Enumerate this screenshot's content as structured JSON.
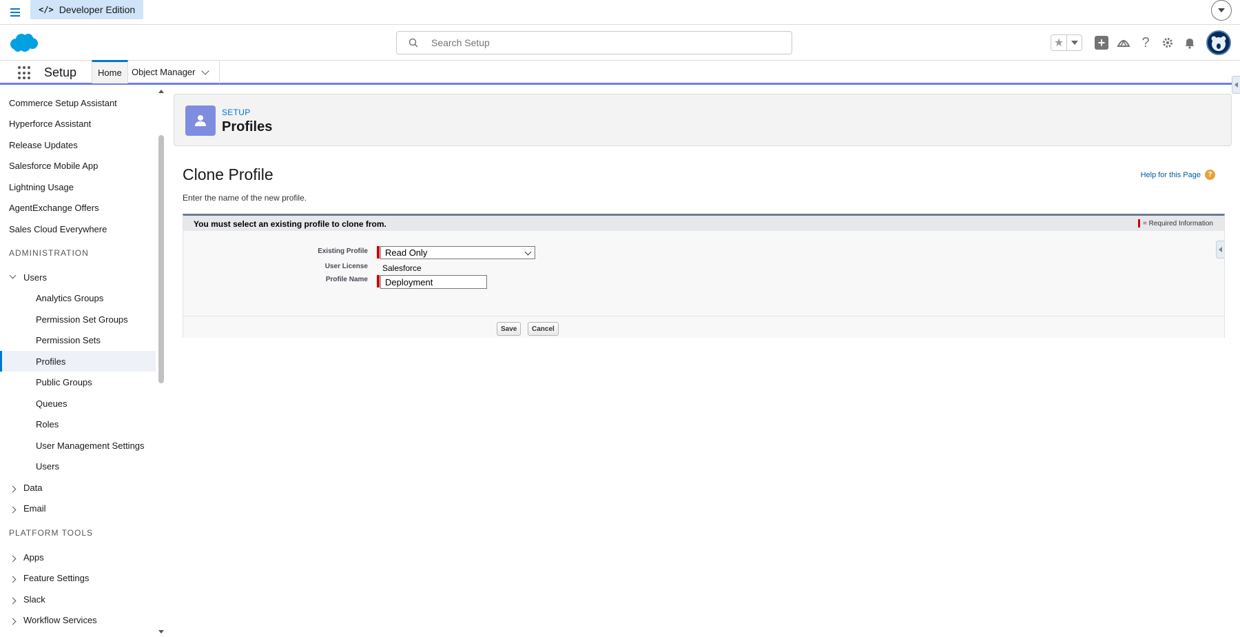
{
  "topbar": {
    "edition_label": "Developer Edition"
  },
  "header": {
    "search_placeholder": "Search Setup"
  },
  "navbar": {
    "app_name": "Setup",
    "tab_home": "Home",
    "tab_object_manager": "Object Manager"
  },
  "sidebar": {
    "items_top": [
      "Commerce Setup Assistant",
      "Hyperforce Assistant",
      "Release Updates",
      "Salesforce Mobile App",
      "Lightning Usage",
      "AgentExchange Offers",
      "Sales Cloud Everywhere"
    ],
    "heading_admin": "ADMINISTRATION",
    "users_group": "Users",
    "users_children": [
      "Analytics Groups",
      "Permission Set Groups",
      "Permission Sets",
      "Profiles",
      "Public Groups",
      "Queues",
      "Roles",
      "User Management Settings",
      "Users"
    ],
    "active_item": "Profiles",
    "data_group": "Data",
    "email_group": "Email",
    "heading_platform": "PLATFORM TOOLS",
    "platform_groups": [
      "Apps",
      "Feature Settings",
      "Slack",
      "Workflow Services"
    ]
  },
  "page_header": {
    "eyebrow": "SETUP",
    "title": "Profiles"
  },
  "clone": {
    "title": "Clone Profile",
    "help_link": "Help for this Page",
    "help_icon_glyph": "?",
    "instructions": "Enter the name of the new profile.",
    "banner": "You must select an existing profile to clone from.",
    "required_info": "= Required Information",
    "fields": {
      "existing_profile_label": "Existing Profile",
      "existing_profile_value": "Read Only",
      "user_license_label": "User License",
      "user_license_value": "Salesforce",
      "profile_name_label": "Profile Name",
      "profile_name_value": "Deployment"
    },
    "save_label": "Save",
    "cancel_label": "Cancel"
  },
  "colors": {
    "brand_blue": "#0176d3",
    "required_red": "#c00000",
    "profile_icon_bg": "#7f8de1"
  },
  "icons": [
    "hamburger-icon",
    "code-icon",
    "salesforce-cloud-logo",
    "search-icon",
    "star-icon",
    "plus-icon",
    "trailhead-icon",
    "help-icon",
    "gear-icon",
    "bell-icon",
    "avatar",
    "app-launcher-icon",
    "user-icon"
  ]
}
